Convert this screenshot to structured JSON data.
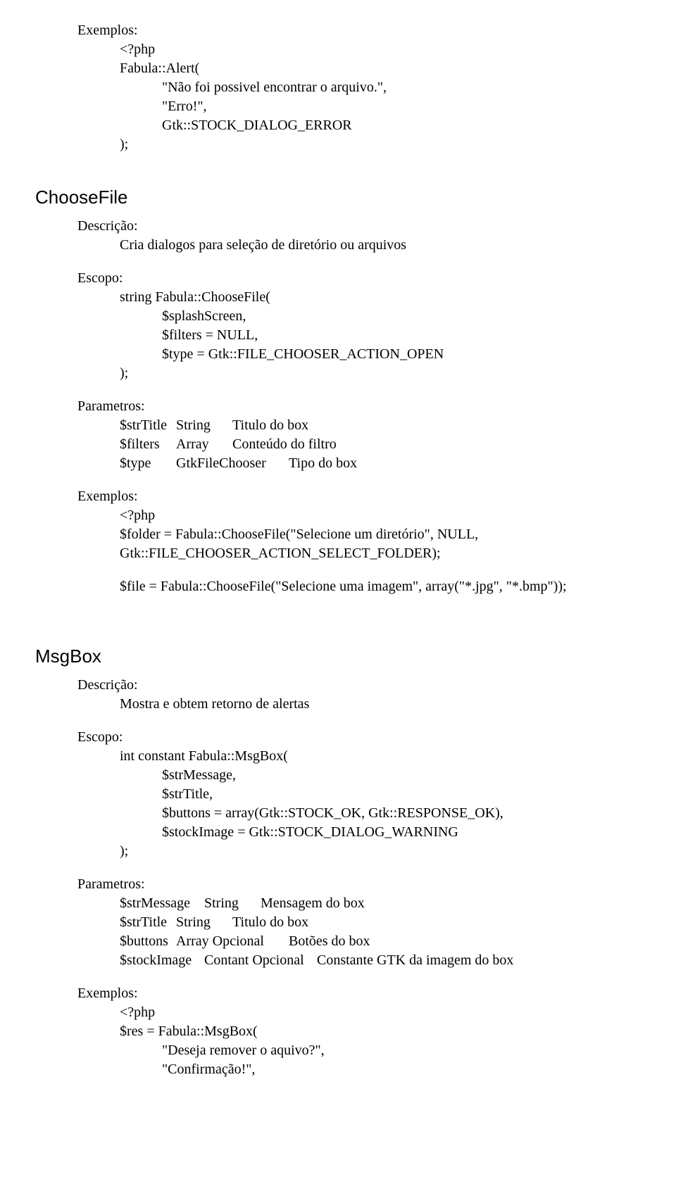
{
  "intro": {
    "exemplos_label": "Exemplos:",
    "php_open": "<?php",
    "line1": "Fabula::Alert(",
    "line2": "\"Não foi possivel encontrar o arquivo.\",",
    "line3": "\"Erro!\",",
    "line4": "Gtk::STOCK_DIALOG_ERROR",
    "line5": ");"
  },
  "chooseFile": {
    "title": "ChooseFile",
    "descricao_label": "Descrição:",
    "descricao_text": "Cria dialogos para seleção de diretório ou arquivos",
    "escopo_label": "Escopo:",
    "escopo_line1": "string Fabula::ChooseFile(",
    "escopo_line2": "$splashScreen,",
    "escopo_line3": "$filters = NULL,",
    "escopo_line4": "$type = Gtk::FILE_CHOOSER_ACTION_OPEN",
    "escopo_line5": ");",
    "parametros_label": "Parametros:",
    "param1": "$strTitle\tString\tTitulo do box",
    "param2": "$filters\tArray\tConteúdo do filtro",
    "param3": "$type\tGtkFileChooser\tTipo do box",
    "exemplos_label": "Exemplos:",
    "ex_php": "<?php",
    "ex_line1": "$folder = Fabula::ChooseFile(\"Selecione um diretório\", NULL,",
    "ex_line2": "Gtk::FILE_CHOOSER_ACTION_SELECT_FOLDER);",
    "ex_line3": "$file = Fabula::ChooseFile(\"Selecione uma imagem\", array(\"*.jpg\", \"*.bmp\"));"
  },
  "msgBox": {
    "title": "MsgBox",
    "descricao_label": "Descrição:",
    "descricao_text": "Mostra e obtem retorno de alertas",
    "escopo_label": "Escopo:",
    "escopo_line1": "int constant Fabula::MsgBox(",
    "escopo_line2": "$strMessage,",
    "escopo_line3": "$strTitle,",
    "escopo_line4": "$buttons = array(Gtk::STOCK_OK, Gtk::RESPONSE_OK),",
    "escopo_line5": "$stockImage = Gtk::STOCK_DIALOG_WARNING",
    "escopo_line6": ");",
    "parametros_label": "Parametros:",
    "param1": "$strMessage\tString\tMensagem do box",
    "param2": "$strTitle\tString\tTitulo do box",
    "param3": "$buttons\tArray Opcional\tBotões do box",
    "param4": "$stockImage\tContant Opcional\tConstante GTK da imagem do box",
    "exemplos_label": "Exemplos:",
    "ex_php": "<?php",
    "ex_line1": "$res = Fabula::MsgBox(",
    "ex_line2": "\"Deseja remover o aquivo?\",",
    "ex_line3": "\"Confirmação!\","
  }
}
